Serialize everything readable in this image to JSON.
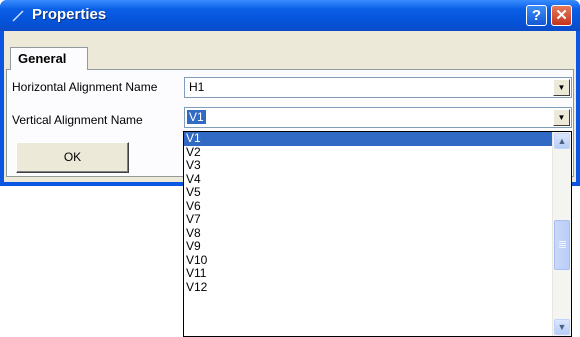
{
  "window": {
    "title": "Properties",
    "help_label": "?",
    "close_label": "✕"
  },
  "tabs": [
    {
      "label": "General",
      "selected": true
    }
  ],
  "fields": {
    "horizontal": {
      "label": "Horizontal Alignment Name",
      "value": "H1"
    },
    "vertical": {
      "label": "Vertical Alignment Name",
      "value": "V1"
    }
  },
  "buttons": {
    "ok_label": "OK"
  },
  "dropdown": {
    "items": [
      "V1",
      "V2",
      "V3",
      "V4",
      "V5",
      "V6",
      "V7",
      "V8",
      "V9",
      "V10",
      "V11",
      "V12"
    ],
    "selected_index": 0
  },
  "icons": {
    "dropdown_arrow": "chevron-down-icon",
    "scroll_up": "chevron-up-icon",
    "scroll_down": "chevron-down-icon"
  },
  "colors": {
    "titlebar": "#0553d8",
    "selection": "#316ac5",
    "dialog_face": "#ece9d8"
  }
}
